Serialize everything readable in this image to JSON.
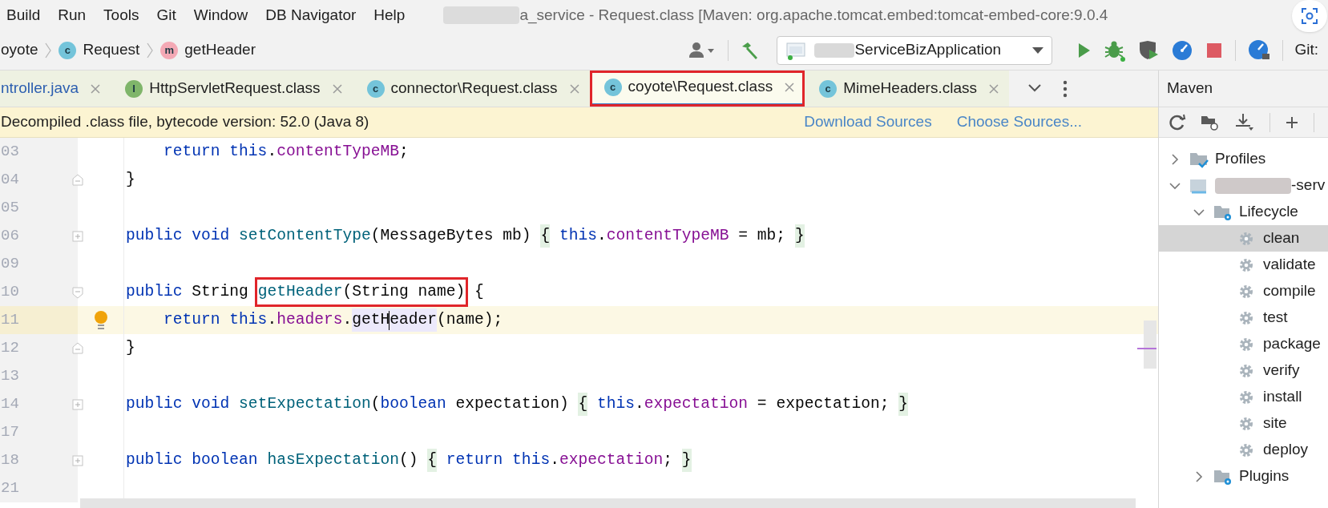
{
  "menu": [
    "Build",
    "Run",
    "Tools",
    "Git",
    "Window",
    "DB Navigator",
    "Help"
  ],
  "window": {
    "title": "a_service - Request.class [Maven: org.apache.tomcat.embed:tomcat-embed-core:9.0.4"
  },
  "breadcrumb": [
    {
      "label": "oyote"
    },
    {
      "label": "Request",
      "badge": {
        "letter": "c",
        "color": "#74c4da"
      }
    },
    {
      "label": "getHeader",
      "badge": {
        "letter": "m",
        "color": "#f4a9b5"
      }
    }
  ],
  "run_config": {
    "label": "ServiceBizApplication"
  },
  "vcs": {
    "label": "Git:"
  },
  "tabs": [
    {
      "label": "ntroller.java",
      "selected": false,
      "outlined": false
    },
    {
      "label": "HttpServletRequest.class",
      "badge": {
        "letter": "I",
        "color": "#7fb56a"
      },
      "selected": false,
      "outlined": false
    },
    {
      "label": "connector\\Request.class",
      "badge": {
        "letter": "c",
        "color": "#74c4da"
      },
      "selected": false,
      "outlined": false
    },
    {
      "label": "coyote\\Request.class",
      "badge": {
        "letter": "c",
        "color": "#74c4da"
      },
      "selected": true,
      "outlined": true
    },
    {
      "label": "MimeHeaders.class",
      "badge": {
        "letter": "c",
        "color": "#74c4da"
      },
      "selected": false,
      "outlined": false
    }
  ],
  "banner": {
    "text": "Decompiled .class file, bytecode version: 52.0 (Java 8)",
    "links": [
      "Download Sources",
      "Choose Sources..."
    ]
  },
  "editor": {
    "lines": [
      {
        "number": "03",
        "current": false,
        "bulb": false,
        "tokens": [
          {
            "t": "    return ",
            "kind": "keyword"
          },
          {
            "t": "this",
            "kind": "keyword"
          },
          {
            "t": ".",
            "kind": "plain"
          },
          {
            "t": "contentTypeMB",
            "kind": "field"
          },
          {
            "t": ";",
            "kind": "plain"
          }
        ]
      },
      {
        "number": "04",
        "current": false,
        "bulb": false,
        "fold": {
          "kind": "end"
        },
        "tokens": [
          {
            "t": "}",
            "kind": "plain"
          }
        ]
      },
      {
        "number": "05",
        "current": false,
        "bulb": false
      },
      {
        "number": "06",
        "current": false,
        "bulb": false,
        "fold": {
          "kind": "collapsed"
        },
        "tokens": [
          {
            "t": "public void ",
            "kind": "keyword"
          },
          {
            "t": "setContentType",
            "kind": "method"
          },
          {
            "t": "(MessageBytes mb) ",
            "kind": "plain"
          },
          {
            "t": "{",
            "kind": "brace"
          },
          {
            "t": " this",
            "kind": "keyword"
          },
          {
            "t": ".",
            "kind": "plain"
          },
          {
            "t": "contentTypeMB",
            "kind": "field"
          },
          {
            "t": " = mb; ",
            "kind": "plain"
          },
          {
            "t": "}",
            "kind": "brace"
          }
        ]
      },
      {
        "number": "09",
        "current": false,
        "bulb": false
      },
      {
        "number": "10",
        "current": false,
        "bulb": false,
        "fold": {
          "kind": "start"
        },
        "tokens": [
          {
            "t": "public ",
            "kind": "keyword"
          },
          {
            "t": "String ",
            "kind": "plain"
          },
          {
            "kind": "boxed",
            "parts": [
              {
                "t": "getHeader",
                "kind": "method"
              },
              {
                "t": "(String name)",
                "kind": "plain"
              }
            ]
          },
          {
            "t": " {",
            "kind": "plain"
          }
        ]
      },
      {
        "number": "11",
        "current": true,
        "bulb": true,
        "tokens": [
          {
            "t": "    return this",
            "kind": "keyword"
          },
          {
            "t": ".",
            "kind": "plain"
          },
          {
            "t": "headers",
            "kind": "field"
          },
          {
            "t": ".",
            "kind": "plain"
          },
          {
            "t": "getH",
            "kind": "usage"
          },
          {
            "kind": "caret"
          },
          {
            "t": "eader",
            "kind": "usage"
          },
          {
            "t": "(name);",
            "kind": "plain"
          }
        ]
      },
      {
        "number": "12",
        "current": false,
        "bulb": false,
        "fold": {
          "kind": "end"
        },
        "tokens": [
          {
            "t": "}",
            "kind": "plain"
          }
        ]
      },
      {
        "number": "13",
        "current": false,
        "bulb": false
      },
      {
        "number": "14",
        "current": false,
        "bulb": false,
        "fold": {
          "kind": "collapsed"
        },
        "tokens": [
          {
            "t": "public void ",
            "kind": "keyword"
          },
          {
            "t": "setExpectation",
            "kind": "method"
          },
          {
            "t": "(",
            "kind": "plain"
          },
          {
            "t": "boolean",
            "kind": "keyword"
          },
          {
            "t": " expectation) ",
            "kind": "plain"
          },
          {
            "t": "{",
            "kind": "brace"
          },
          {
            "t": " this",
            "kind": "keyword"
          },
          {
            "t": ".",
            "kind": "plain"
          },
          {
            "t": "expectation",
            "kind": "field"
          },
          {
            "t": " = expectation; ",
            "kind": "plain"
          },
          {
            "t": "}",
            "kind": "brace"
          }
        ]
      },
      {
        "number": "17",
        "current": false,
        "bulb": false
      },
      {
        "number": "18",
        "current": false,
        "bulb": false,
        "fold": {
          "kind": "collapsed"
        },
        "tokens": [
          {
            "t": "public boolean ",
            "kind": "keyword"
          },
          {
            "t": "hasExpectation",
            "kind": "method"
          },
          {
            "t": "() ",
            "kind": "plain"
          },
          {
            "t": "{",
            "kind": "brace"
          },
          {
            "t": " return this",
            "kind": "keyword"
          },
          {
            "t": ".",
            "kind": "plain"
          },
          {
            "t": "expectation",
            "kind": "field"
          },
          {
            "t": "; ",
            "kind": "plain"
          },
          {
            "t": "}",
            "kind": "brace"
          }
        ]
      },
      {
        "number": "21",
        "current": false,
        "bulb": false
      }
    ]
  },
  "maven": {
    "title": "Maven",
    "tree": [
      {
        "label": "Profiles",
        "kind": "profiles",
        "expanded": false,
        "selected": false
      },
      {
        "label": "-serv",
        "kind": "project",
        "expanded": true,
        "selected": false,
        "children": [
          {
            "label": "Lifecycle",
            "kind": "lifecycle",
            "expanded": true,
            "selected": false,
            "children": [
              {
                "label": "clean",
                "kind": "goal",
                "selected": true
              },
              {
                "label": "validate",
                "kind": "goal",
                "selected": false
              },
              {
                "label": "compile",
                "kind": "goal",
                "selected": false
              },
              {
                "label": "test",
                "kind": "goal",
                "selected": false
              },
              {
                "label": "package",
                "kind": "goal",
                "selected": false
              },
              {
                "label": "verify",
                "kind": "goal",
                "selected": false
              },
              {
                "label": "install",
                "kind": "goal",
                "selected": false
              },
              {
                "label": "site",
                "kind": "goal",
                "selected": false
              },
              {
                "label": "deploy",
                "kind": "goal",
                "selected": false
              }
            ]
          },
          {
            "label": "Plugins",
            "kind": "lifecycle",
            "expanded": false,
            "selected": false
          }
        ]
      }
    ]
  }
}
